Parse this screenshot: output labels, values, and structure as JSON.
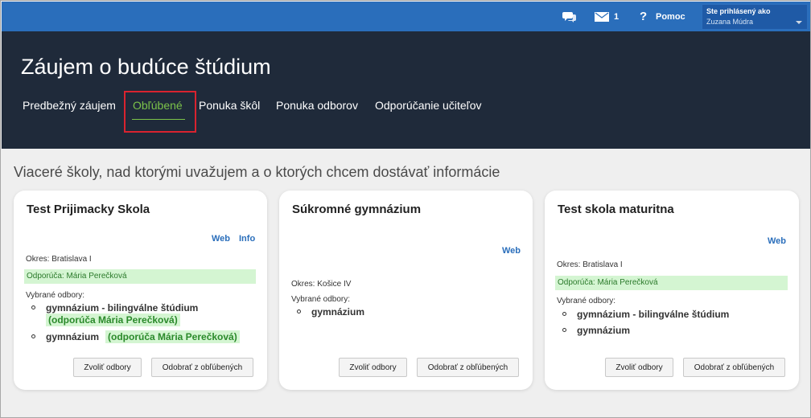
{
  "topbar": {
    "chat_icon": "chat-bubbles-icon",
    "mail_icon": "envelope-icon",
    "mail_count": "1",
    "help_icon": "question-icon",
    "help_label": "Pomoc",
    "user_title": "Ste prihlásený ako",
    "user_name": "Zuzana Múdra"
  },
  "header": {
    "title": "Záujem o budúce štúdium",
    "tabs": [
      {
        "label": "Predbežný záujem"
      },
      {
        "label": "Obľúbené",
        "active": true
      },
      {
        "label": "Ponuka škôl"
      },
      {
        "label": "Ponuka odborov"
      },
      {
        "label": "Odporúčanie učiteľov"
      }
    ]
  },
  "main": {
    "subtitle": "Viaceré školy, nad ktorými uvažujem a o ktorých chcem dostávať informácie",
    "cards": [
      {
        "title": "Test Prijimacky Skola",
        "links": [
          "Web",
          "Info"
        ],
        "okres": "Okres: Bratislava I",
        "odporuca": "Odporúča: Mária Perečková",
        "fields_label": "Vybrané odbory:",
        "fields": [
          {
            "name": "gymnázium - bilingválne štúdium",
            "note": "(odporúča Mária Perečková)"
          },
          {
            "name": "gymnázium",
            "note": "(odporúča Mária Perečková)"
          }
        ],
        "btn_choose": "Zvoliť odbory",
        "btn_remove": "Odobrať z obľúbených"
      },
      {
        "title": "Súkromné gymnázium",
        "links": [
          "Web"
        ],
        "okres": "Okres: Košice IV",
        "fields_label": "Vybrané odbory:",
        "fields": [
          {
            "name": "gymnázium"
          }
        ],
        "btn_choose": "Zvoliť odbory",
        "btn_remove": "Odobrať z obľúbených"
      },
      {
        "title": "Test skola maturitna",
        "links": [
          "Web"
        ],
        "okres": "Okres: Bratislava I",
        "odporuca": "Odporúča: Mária Perečková",
        "fields_label": "Vybrané odbory:",
        "fields": [
          {
            "name": "gymnázium - bilingválne štúdium"
          },
          {
            "name": "gymnázium"
          }
        ],
        "btn_choose": "Zvoliť odbory",
        "btn_remove": "Odobrať z obľúbených"
      }
    ]
  },
  "colors": {
    "topbar": "#2a6ebb",
    "header": "#1f2a3a",
    "active_tab": "#7cc34a",
    "recommend_bg": "#d4f5d2",
    "recommend_text": "#2b8a2b",
    "link": "#2a6ebb",
    "highlight_box": "#d9232f"
  }
}
